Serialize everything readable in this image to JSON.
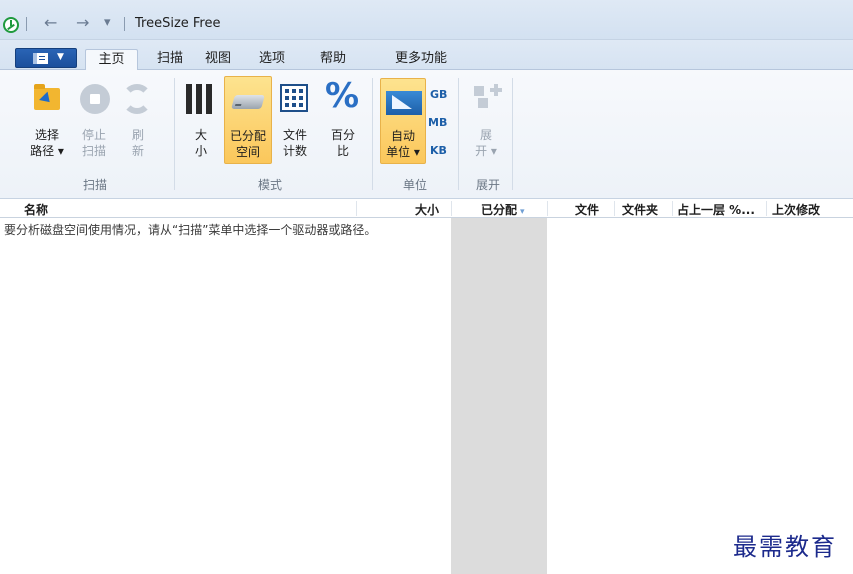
{
  "window": {
    "title": "TreeSize Free",
    "qat": {
      "back_glyph": "←",
      "forward_glyph": "→",
      "dropdown_glyph": "▾"
    }
  },
  "tabs": [
    "主页",
    "扫描",
    "视图",
    "选项",
    "帮助",
    "更多功能"
  ],
  "active_tab": "主页",
  "ribbon": {
    "scan_group": {
      "label": "扫描",
      "select_path": {
        "line1": "选择",
        "line2": "路径 ▾"
      },
      "stop_scan": {
        "line1": "停止",
        "line2": "扫描"
      },
      "refresh": {
        "line1": "刷",
        "line2": "新"
      }
    },
    "mode_group": {
      "label": "模式",
      "size": {
        "line1": "大",
        "line2": "小"
      },
      "allocated": {
        "line1": "已分配",
        "line2": "空间"
      },
      "file_count": {
        "line1": "文件",
        "line2": "计数"
      },
      "percent": {
        "line1": "百分",
        "line2": "比",
        "glyph": "%"
      }
    },
    "unit_group": {
      "label": "单位",
      "auto_unit": {
        "line1": "自动",
        "line2": "单位 ▾"
      },
      "gb": "GB",
      "mb": "MB",
      "kb": "KB"
    },
    "expand_group": {
      "label": "展开",
      "expand": {
        "line1": "展",
        "line2": "开 ▾"
      }
    }
  },
  "columns": {
    "name": "名称",
    "size": "大小",
    "allocated": "已分配",
    "sort_glyph": "▾",
    "files": "文件",
    "folders": "文件夹",
    "percent_parent": "占上一层 %...",
    "last_modified": "上次修改"
  },
  "hint": "要分析磁盘空间使用情况，请从“扫描”菜单中选择一个驱动器或路径。",
  "watermark": "最需教育",
  "colors": {
    "accent": "#1b4f9c",
    "selected": "#fbc75b",
    "allocated_column": "#dcdcdc"
  }
}
